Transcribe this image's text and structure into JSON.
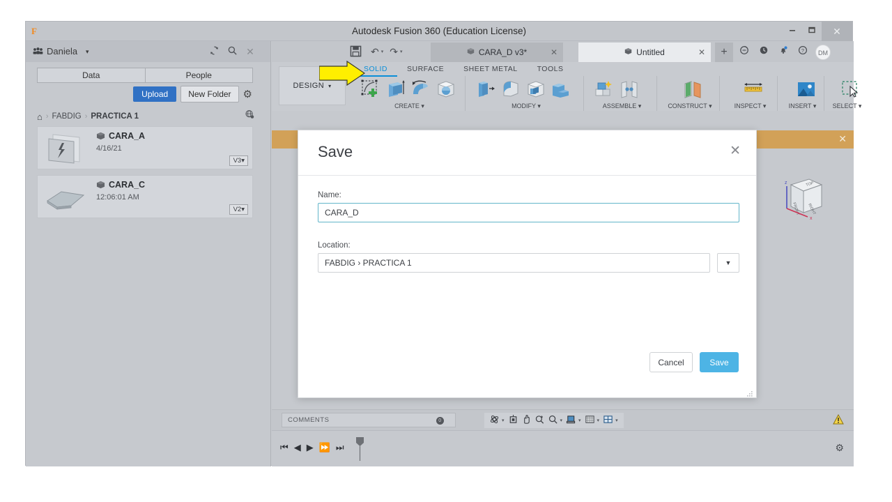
{
  "window": {
    "title": "Autodesk Fusion 360 (Education License)",
    "logo": "fusion-logo",
    "minimize": "–",
    "maximize": "❐",
    "close": "✕"
  },
  "data_panel": {
    "user": "Daniela",
    "user_caret": "▾",
    "refresh": "⟳",
    "search": "⌕",
    "close": "✕",
    "tabs": [
      {
        "label": "Data"
      },
      {
        "label": "People"
      }
    ],
    "upload_label": "Upload",
    "new_folder_label": "New Folder",
    "gear": "⚙",
    "breadcrumb": {
      "home": "⌂",
      "separator": "›",
      "items": [
        "FABDIG",
        "PRACTICA 1"
      ]
    },
    "globe": "⊕",
    "files": [
      {
        "name": "CARA_A",
        "date": "4/16/21",
        "version": "V3",
        "caret": "▾"
      },
      {
        "name": "CARA_C",
        "date": "12:06:01 AM",
        "version": "V2",
        "caret": "▾"
      }
    ]
  },
  "tabstrip": {
    "save": "save-icon",
    "undo": "↶",
    "redo": "↷",
    "mini_caret": "▾",
    "documents": [
      {
        "label": "CARA_D v3*",
        "close": "✕",
        "active": false
      },
      {
        "label": "Untitled",
        "close": "✕",
        "active": true
      }
    ],
    "add_tab": "+",
    "icons": [
      "job-status-icon",
      "recent-icon",
      "notifications-icon",
      "help-icon"
    ],
    "avatar": "DM"
  },
  "ribbon": {
    "workspace": "DESIGN",
    "workspace_caret": "▾",
    "tabs": [
      {
        "label": "SOLID",
        "active": true
      },
      {
        "label": "SURFACE",
        "active": false
      },
      {
        "label": "SHEET METAL",
        "active": false
      },
      {
        "label": "TOOLS",
        "active": false
      }
    ],
    "panels": [
      {
        "label": "CREATE ▾",
        "icons": [
          "create-sketch-icon",
          "extrude-icon",
          "revolve-icon",
          "sphere-icon"
        ]
      },
      {
        "label": "MODIFY ▾",
        "icons": [
          "press-pull-icon",
          "fillet-icon",
          "shell-icon",
          "combine-icon"
        ]
      },
      {
        "label": "ASSEMBLE ▾",
        "icons": [
          "new-component-icon",
          "joint-icon"
        ]
      },
      {
        "label": "CONSTRUCT ▾",
        "icons": [
          "offset-plane-icon"
        ]
      },
      {
        "label": "INSPECT ▾",
        "icons": [
          "measure-icon"
        ]
      },
      {
        "label": "INSERT ▾",
        "icons": [
          "insert-image-icon"
        ]
      },
      {
        "label": "SELECT ▾",
        "icons": [
          "select-window-icon"
        ]
      }
    ]
  },
  "notification_bar": {
    "close": "✕"
  },
  "viewport": {
    "viewcube": {
      "top": "TOP",
      "front": "FRONT",
      "right": "RIGHT",
      "axis_z": "z",
      "axis_x": "x"
    }
  },
  "bottom": {
    "comments_label": "COMMENTS",
    "comments_count": "0",
    "nav_icons": [
      "orbit-icon",
      "look-at-icon",
      "pan-icon",
      "zoom-window-icon",
      "zoom-icon",
      "display-settings-icon",
      "grid-snaps-icon",
      "viewports-icon"
    ],
    "caret": "▾",
    "warning": "⚠"
  },
  "timeline": {
    "controls": [
      "⏮",
      "◀",
      "▶",
      "⏩",
      "⏭"
    ],
    "gear": "⚙"
  },
  "save_dialog": {
    "title": "Save",
    "close": "✕",
    "name_label": "Name:",
    "name_value": "CARA_D",
    "name_placeholder": "Name",
    "location_label": "Location:",
    "location_value": "FABDIG › PRACTICA 1",
    "location_placeholder": "Location",
    "location_caret": "▼",
    "cancel_label": "Cancel",
    "save_label": "Save"
  },
  "annotation": {
    "arrow": "yellow-right-arrow"
  },
  "colors": {
    "accent_blue": "#4db4e5",
    "upload_blue": "#3071c4",
    "ribbon_active": "#0a8fd8",
    "notification_orange": "#d2a158",
    "arrow_yellow": "#ffef00",
    "window_chrome": "#c6c9ce"
  }
}
